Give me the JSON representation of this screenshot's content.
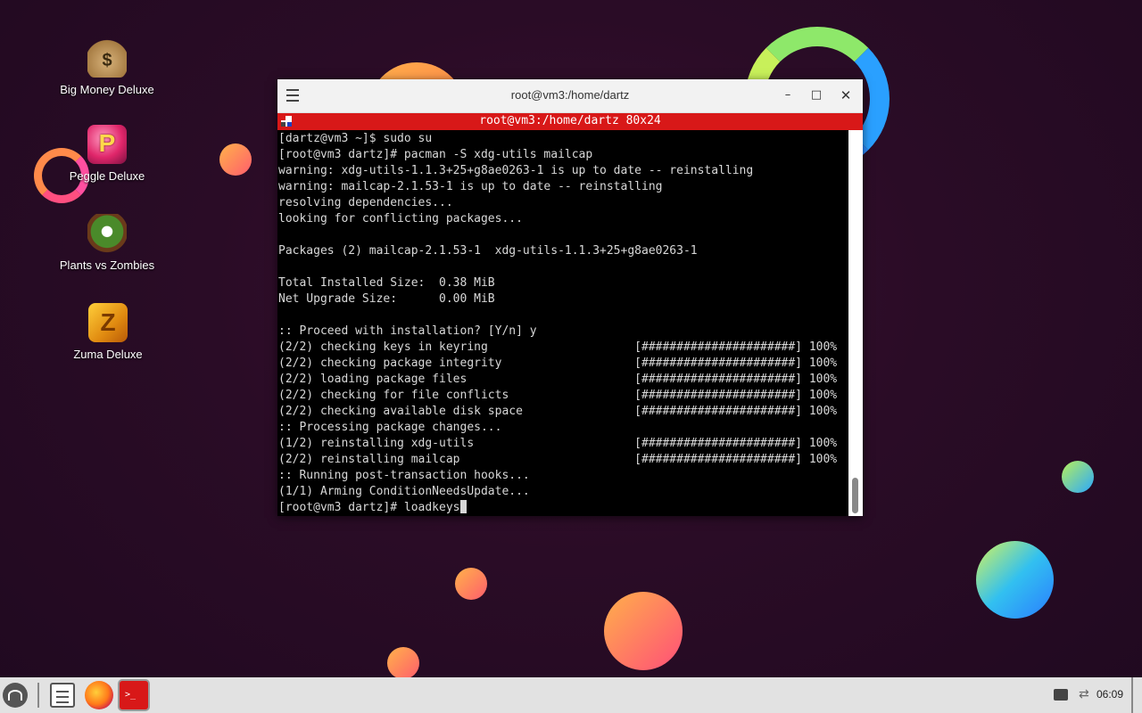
{
  "desktop": {
    "icons": [
      {
        "label": "Big Money Deluxe",
        "glyph": "$"
      },
      {
        "label": "Peggle Deluxe",
        "glyph": "P"
      },
      {
        "label": "Plants vs Zombies"
      },
      {
        "label": "Zuma Deluxe",
        "glyph": "Z"
      }
    ]
  },
  "window": {
    "title": "root@vm3:/home/dartz",
    "terminal_title": "root@vm3:/home/dartz 80x24",
    "controls": {
      "minimize": "–",
      "maximize": "□",
      "close": "✕"
    },
    "lines": [
      "[dartz@vm3 ~]$ sudo su",
      "[root@vm3 dartz]# pacman -S xdg-utils mailcap",
      "warning: xdg-utils-1.1.3+25+g8ae0263-1 is up to date -- reinstalling",
      "warning: mailcap-2.1.53-1 is up to date -- reinstalling",
      "resolving dependencies...",
      "looking for conflicting packages...",
      "",
      "Packages (2) mailcap-2.1.53-1  xdg-utils-1.1.3+25+g8ae0263-1",
      "",
      "Total Installed Size:  0.38 MiB",
      "Net Upgrade Size:      0.00 MiB",
      "",
      ":: Proceed with installation? [Y/n] y",
      "(2/2) checking keys in keyring                     [######################] 100%",
      "(2/2) checking package integrity                   [######################] 100%",
      "(2/2) loading package files                        [######################] 100%",
      "(2/2) checking for file conflicts                  [######################] 100%",
      "(2/2) checking available disk space                [######################] 100%",
      ":: Processing package changes...",
      "(1/2) reinstalling xdg-utils                       [######################] 100%",
      "(2/2) reinstalling mailcap                         [######################] 100%",
      ":: Running post-transaction hooks...",
      "(1/1) Arming ConditionNeedsUpdate..."
    ],
    "prompt_line": "[root@vm3 dartz]# loadkeys"
  },
  "taskbar": {
    "clock": "06:09",
    "icons": [
      "start-menu-icon",
      "file-manager-icon",
      "firefox-icon",
      "terminal-icon",
      "printer-icon",
      "network-icon"
    ]
  }
}
